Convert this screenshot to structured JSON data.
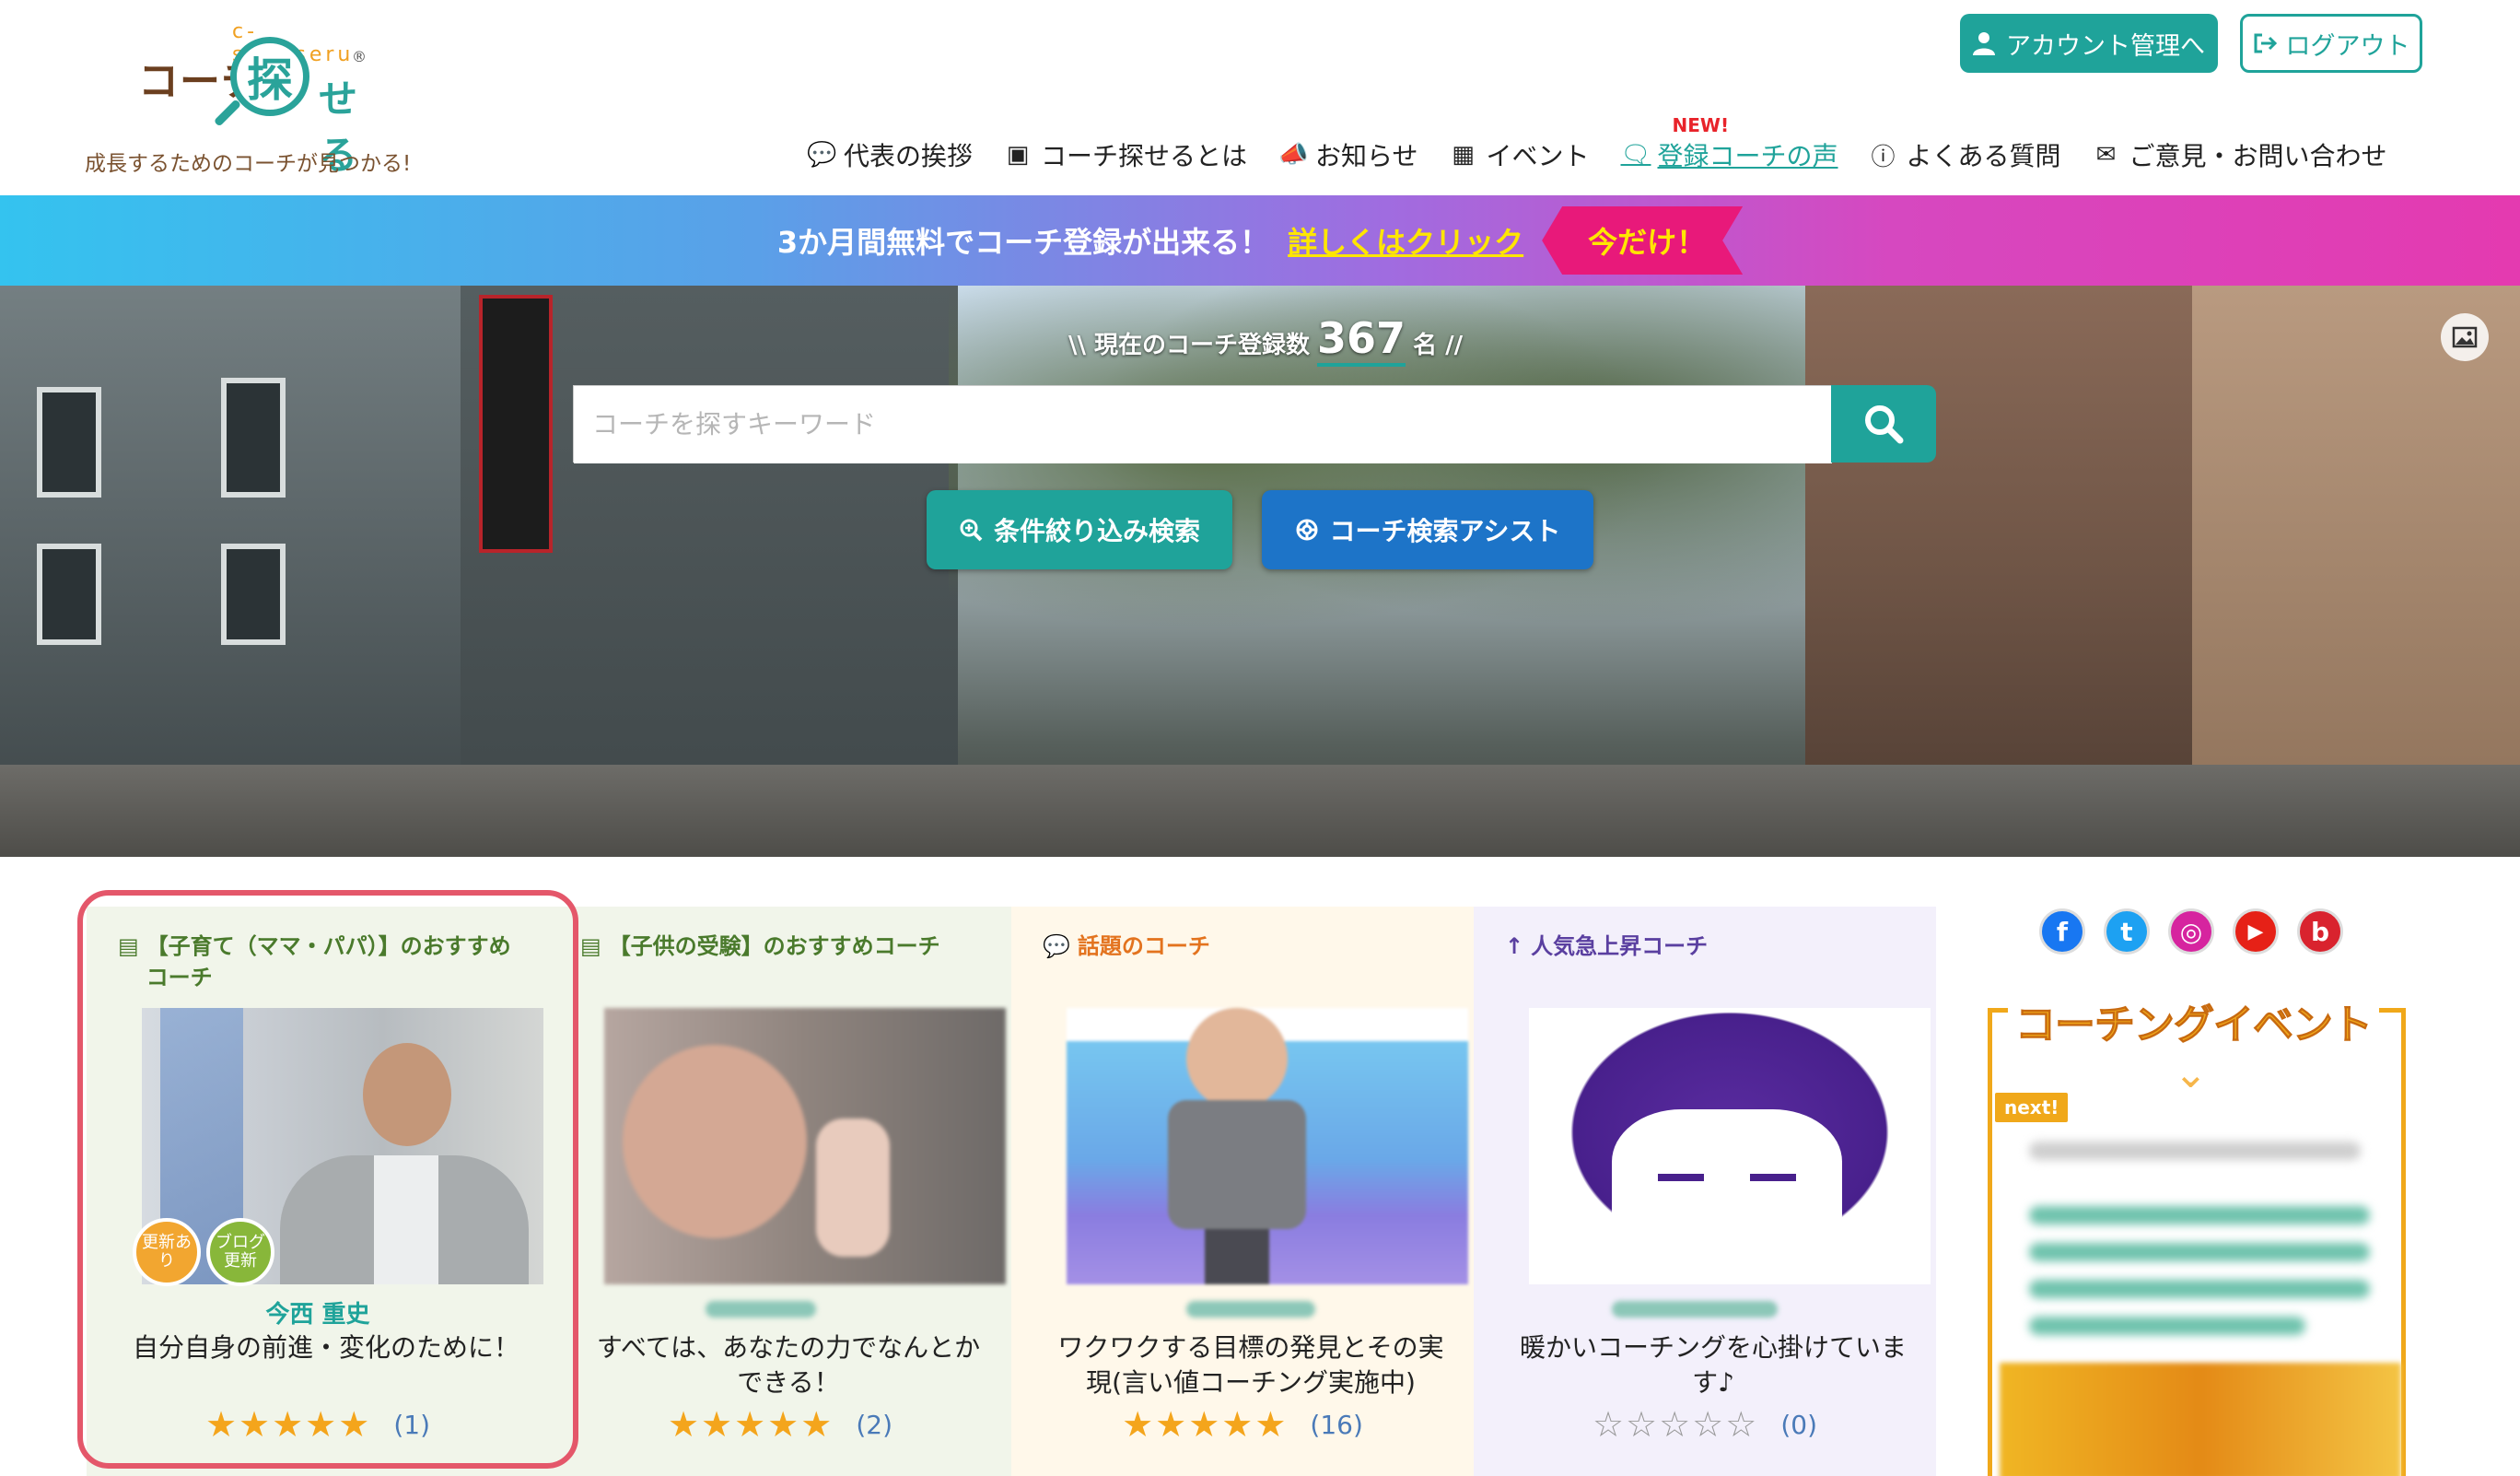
{
  "header": {
    "logo": {
      "text_main": "コーチ",
      "text_kanji": "探",
      "text_suffix": "せる",
      "rays": "c-sagaseru",
      "reg": "®"
    },
    "tagline": "成長するためのコーチが見つかる!",
    "account_button": "アカウント管理へ",
    "logout_button": "ログアウト",
    "nav": [
      {
        "label": "代表の挨拶",
        "icon": "speech-bubble-icon"
      },
      {
        "label": "コーチ探せるとは",
        "icon": "presenter-icon"
      },
      {
        "label": "お知らせ",
        "icon": "megaphone-icon"
      },
      {
        "label": "イベント",
        "icon": "calendar-icon"
      },
      {
        "label": "登録コーチの声",
        "icon": "chat-icon",
        "badge": "NEW!"
      },
      {
        "label": "よくある質問",
        "icon": "question-icon"
      },
      {
        "label": "ご意見・お問い合わせ",
        "icon": "mail-icon"
      }
    ]
  },
  "promo": {
    "text": "3か月間無料でコーチ登録が出来る！",
    "link": "詳しくはクリック",
    "tag": "今だけ！"
  },
  "hero": {
    "count_prefix": "\\\\ 現在のコーチ登録数",
    "count": "367",
    "count_suffix": "名 //",
    "search_placeholder": "コーチを探すキーワード",
    "filter_button": "条件絞り込み検索",
    "assist_button": "コーチ検索アシスト"
  },
  "cards": [
    {
      "category": "【子育て（ママ・パパ）】のおすすめコーチ",
      "name": "今西 重史",
      "desc": "自分自身の前進・変化のために！",
      "stars": "★★★★★",
      "count": "(1)",
      "badges": [
        "更新あり",
        "ブログ更新"
      ]
    },
    {
      "category": "【子供の受験】のおすすめコーチ",
      "name": "",
      "desc": "すべては、あなたの力でなんとかできる！",
      "stars": "★★★★★",
      "count": "(2)"
    },
    {
      "category": "話題のコーチ",
      "name": "",
      "desc": "ワクワクする目標の発見とその実現(言い値コーチング実施中)",
      "stars": "★★★★★",
      "count": "(16)"
    },
    {
      "category": "人気急上昇コーチ",
      "name": "",
      "desc": "暖かいコーチングを心掛けています♪",
      "stars": "☆☆☆☆☆",
      "count": "(0)"
    }
  ],
  "sidebar": {
    "social": [
      {
        "name": "facebook-icon",
        "glyph": "f",
        "color": "#1877f2"
      },
      {
        "name": "twitter-icon",
        "glyph": "t",
        "color": "#1da1f2"
      },
      {
        "name": "instagram-icon",
        "glyph": "◎",
        "color": "#d6249f"
      },
      {
        "name": "youtube-icon",
        "glyph": "▶",
        "color": "#e62117"
      },
      {
        "name": "blog-icon",
        "glyph": "b",
        "color": "#d9232e"
      }
    ],
    "event_title": "コーチングイベント",
    "event_next": "next!"
  }
}
